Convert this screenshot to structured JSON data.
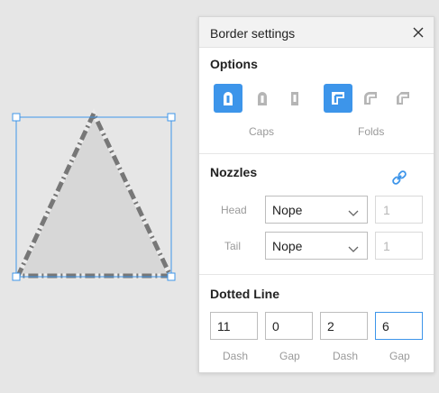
{
  "panel": {
    "title": "Border settings"
  },
  "options": {
    "title": "Options",
    "caps_label": "Caps",
    "folds_label": "Folds",
    "caps": [
      {
        "icon": "cap-round-icon",
        "active": true
      },
      {
        "icon": "cap-rounded-outline-icon",
        "active": false
      },
      {
        "icon": "cap-square-icon",
        "active": false
      }
    ],
    "folds": [
      {
        "icon": "fold-miter-icon",
        "active": true
      },
      {
        "icon": "fold-round-icon",
        "active": false
      },
      {
        "icon": "fold-bevel-icon",
        "active": false
      }
    ]
  },
  "nozzles": {
    "title": "Nozzles",
    "head_label": "Head",
    "tail_label": "Tail",
    "head_value": "Nope",
    "tail_value": "Nope",
    "head_size": "1",
    "tail_size": "1"
  },
  "dotted": {
    "title": "Dotted Line",
    "values": [
      "11",
      "0",
      "2",
      "6"
    ],
    "labels": [
      "Dash",
      "Gap",
      "Dash",
      "Gap"
    ]
  },
  "colors": {
    "accent": "#3d95ea",
    "triangle_fill": "#d7d7d7",
    "triangle_stroke": "#777777"
  }
}
